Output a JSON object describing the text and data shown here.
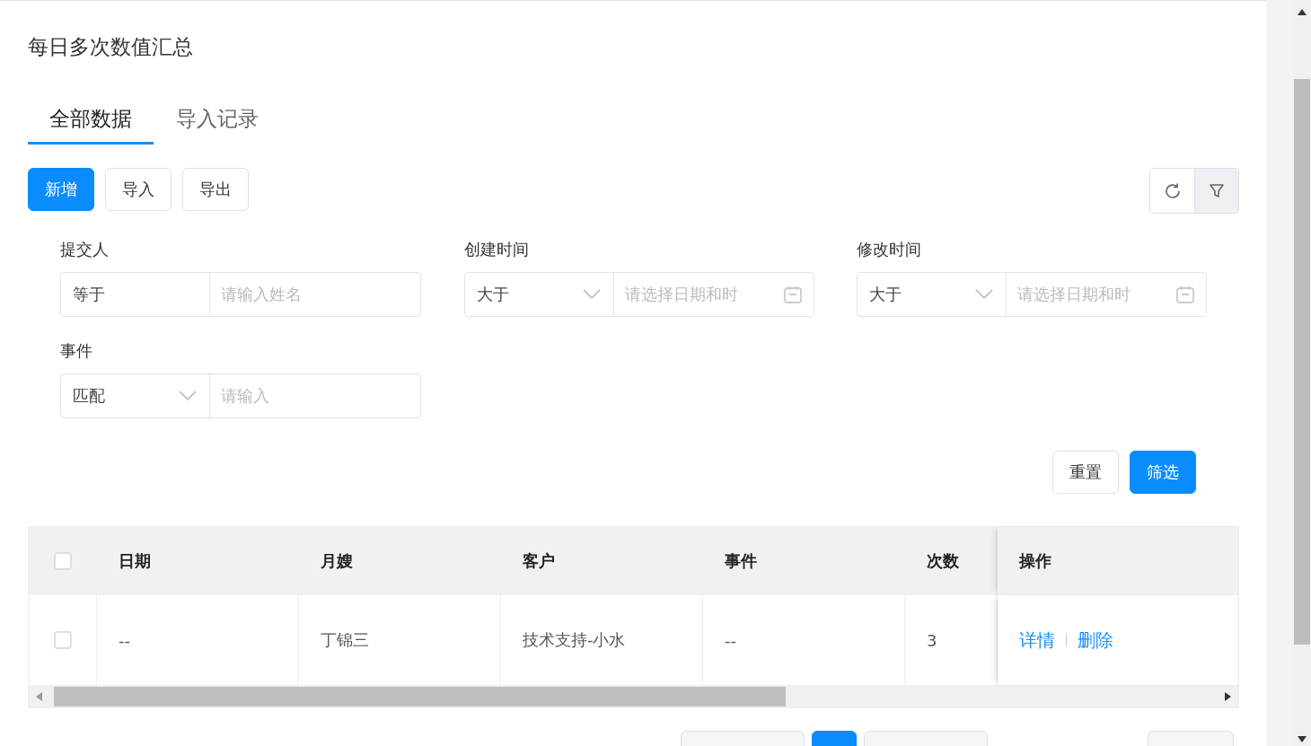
{
  "page_title": "每日多次数值汇总",
  "tabs": [
    {
      "label": "全部数据",
      "selected": true
    },
    {
      "label": "导入记录",
      "selected": false
    }
  ],
  "toolbar_buttons": [
    {
      "label": "新增",
      "kind": "primary"
    },
    {
      "label": "导入",
      "kind": "default"
    },
    {
      "label": "导出",
      "kind": "default"
    }
  ],
  "filters": [
    {
      "label": "提交人",
      "operator": "等于",
      "operator_dropdown": false,
      "placeholder": "请输入姓名",
      "kind": "text"
    },
    {
      "label": "创建时间",
      "operator": "大于",
      "operator_dropdown": true,
      "placeholder": "请选择日期和时",
      "kind": "date"
    },
    {
      "label": "修改时间",
      "operator": "大于",
      "operator_dropdown": true,
      "placeholder": "请选择日期和时",
      "kind": "date"
    },
    {
      "label": "事件",
      "operator": "匹配",
      "operator_dropdown": true,
      "placeholder": "请输入",
      "kind": "text"
    }
  ],
  "filter_buttons": [
    {
      "label": "重置",
      "kind": "default"
    },
    {
      "label": "筛选",
      "kind": "primary"
    }
  ],
  "table": {
    "all_checked": false,
    "columns": [
      "日期",
      "月嫂",
      "客户",
      "事件",
      "次数",
      "操作"
    ],
    "rows": [
      {
        "checked": false,
        "cells": [
          "--",
          "丁锦三",
          "技术支持-小水",
          "--",
          "3"
        ],
        "actions": [
          "详情",
          "删除"
        ]
      }
    ]
  }
}
